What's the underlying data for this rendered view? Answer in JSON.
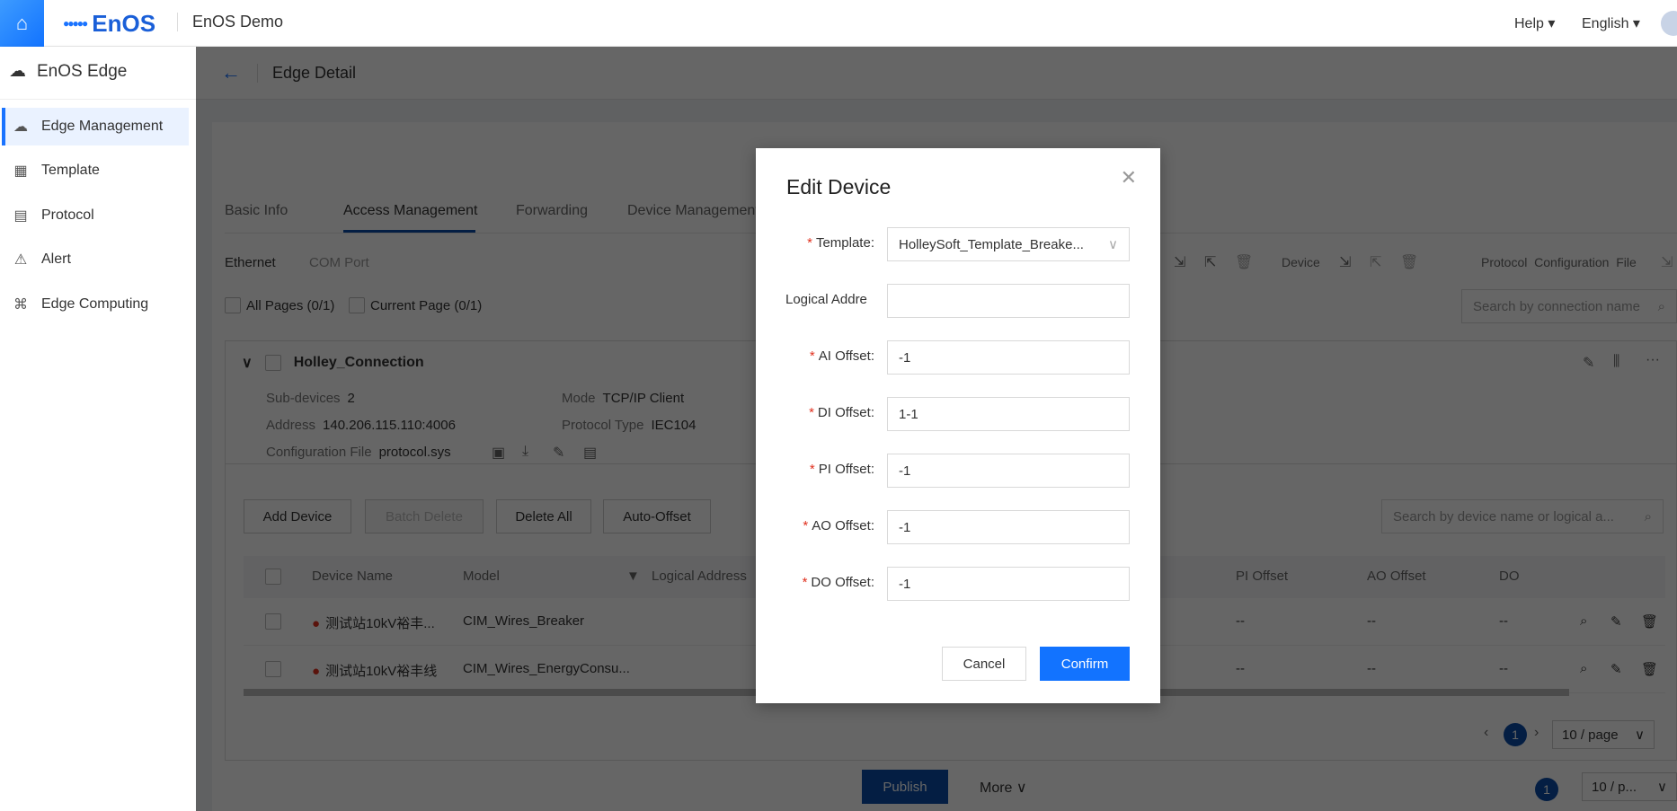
{
  "topbar": {
    "app_name": "EnOS Demo",
    "logo_text": "EnOS",
    "help": "Help ▾",
    "language": "English ▾"
  },
  "sidebar": {
    "title": "EnOS Edge",
    "items": [
      {
        "label": "Edge Management",
        "icon": "edge-cloud-icon",
        "active": true
      },
      {
        "label": "Template",
        "icon": "grid-icon"
      },
      {
        "label": "Protocol",
        "icon": "document-icon"
      },
      {
        "label": "Alert",
        "icon": "alert-bell-icon"
      },
      {
        "label": "Edge Computing",
        "icon": "command-icon"
      }
    ]
  },
  "header": {
    "title": "Edge Detail"
  },
  "tabs": [
    "Basic Info",
    "Access Management",
    "Forwarding",
    "Device Management"
  ],
  "subtabs": [
    "Ethernet",
    "COM Port"
  ],
  "selection": {
    "all_pages": "All Pages (0/1)",
    "current_page": "Current Page (0/1)"
  },
  "toolbar": {
    "device_label": "Device",
    "protocol_label": "Protocol  Configuration  File",
    "search_placeholder": "Search by connection name"
  },
  "connection": {
    "name": "Holley_Connection",
    "sub_devices_label": "Sub-devices",
    "sub_devices": "2",
    "address_label": "Address",
    "address": "140.206.115.110:4006",
    "config_label": "Configuration File",
    "config": "protocol.sys",
    "mode_label": "Mode",
    "mode": "TCP/IP Client",
    "protocol_label": "Protocol Type",
    "protocol": "IEC104"
  },
  "device_actions": {
    "add": "Add Device",
    "batch_delete": "Batch Delete",
    "delete_all": "Delete All",
    "auto_offset": "Auto-Offset",
    "search_placeholder": "Search by device name or logical a..."
  },
  "table": {
    "columns": [
      "Device Name",
      "Model",
      "Logical Address",
      "PI Offset",
      "AO Offset",
      "DO"
    ],
    "rows": [
      {
        "name": "测试站10kV裕丰...",
        "model": "CIM_Wires_Breaker",
        "pi": "--",
        "ao": "--",
        "do": "--"
      },
      {
        "name": "测试站10kV裕丰线",
        "model": "CIM_Wires_EnergyConsu...",
        "pi": "--",
        "ao": "--",
        "do": "--"
      }
    ]
  },
  "pagination": {
    "page": "1",
    "size": "10 / page",
    "outer_page": "1",
    "outer_size": "10 / p..."
  },
  "footer": {
    "publish": "Publish",
    "more": "More"
  },
  "modal": {
    "title": "Edit Device",
    "fields": [
      {
        "label": "Template",
        "required": true,
        "value": "HolleySoft_Template_Breake..."
      },
      {
        "label": "Logical Addre",
        "required": false,
        "value": ""
      },
      {
        "label": "AI Offset",
        "required": true,
        "value": "-1"
      },
      {
        "label": "DI Offset",
        "required": true,
        "value": "1-1"
      },
      {
        "label": "PI Offset",
        "required": true,
        "value": "-1"
      },
      {
        "label": "AO Offset",
        "required": true,
        "value": "-1"
      },
      {
        "label": "DO Offset",
        "required": true,
        "value": "-1"
      }
    ],
    "cancel": "Cancel",
    "confirm": "Confirm"
  },
  "colors": {
    "primary": "#1273ff",
    "dark_primary": "#0a4ca8",
    "required": "#e0301e"
  }
}
